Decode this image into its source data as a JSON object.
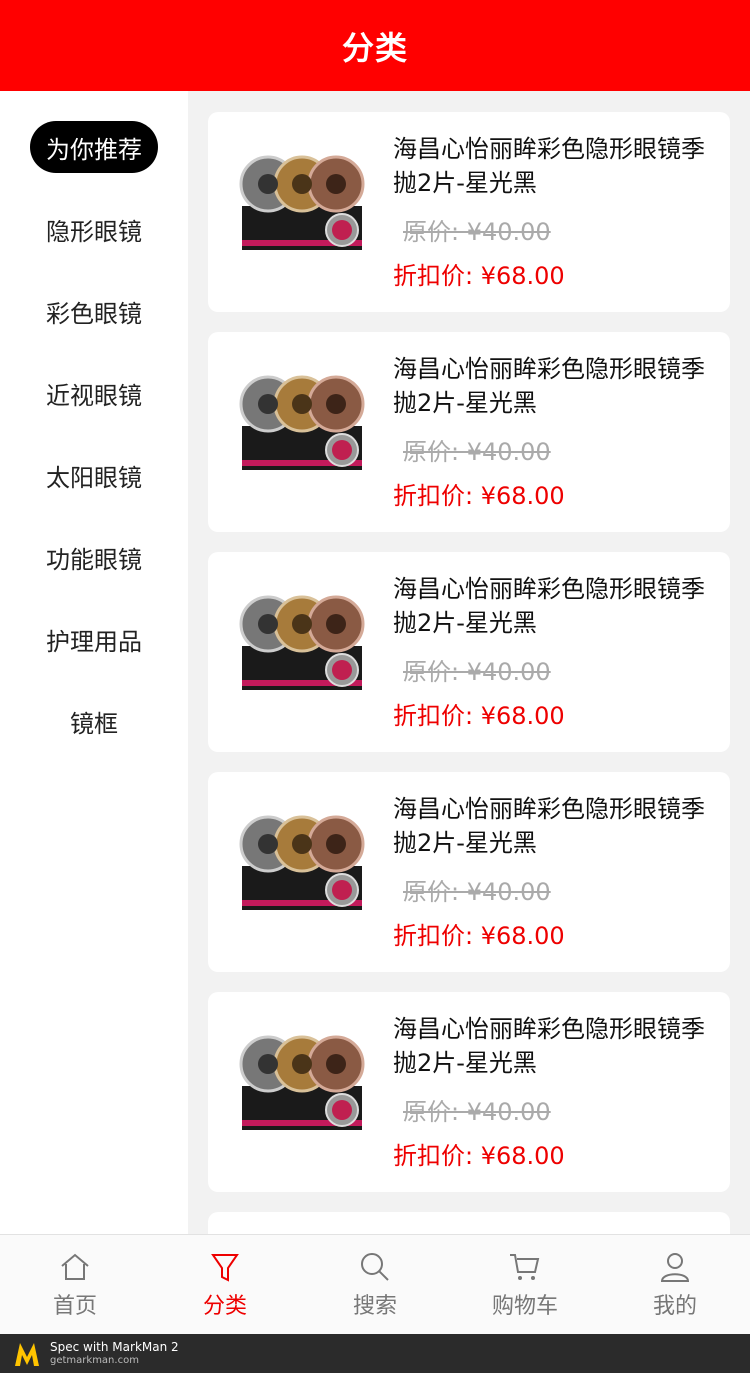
{
  "header": {
    "title": "分类"
  },
  "sidebar": {
    "items": [
      "为你推荐",
      "隐形眼镜",
      "彩色眼镜",
      "近视眼镜",
      "太阳眼镜",
      "功能眼镜",
      "护理用品",
      "镜框"
    ]
  },
  "products": [
    {
      "title": "海昌心怡丽眸彩色隐形眼镜季抛2片-星光黑",
      "original": "原价: ¥40.00",
      "discount": "折扣价: ¥68.00"
    },
    {
      "title": "海昌心怡丽眸彩色隐形眼镜季抛2片-星光黑",
      "original": "原价: ¥40.00",
      "discount": "折扣价: ¥68.00"
    },
    {
      "title": "海昌心怡丽眸彩色隐形眼镜季抛2片-星光黑",
      "original": "原价: ¥40.00",
      "discount": "折扣价: ¥68.00"
    },
    {
      "title": "海昌心怡丽眸彩色隐形眼镜季抛2片-星光黑",
      "original": "原价: ¥40.00",
      "discount": "折扣价: ¥68.00"
    },
    {
      "title": "海昌心怡丽眸彩色隐形眼镜季抛2片-星光黑",
      "original": "原价: ¥40.00",
      "discount": "折扣价: ¥68.00"
    }
  ],
  "tabbar": {
    "items": [
      {
        "label": "首页",
        "icon": "home-icon"
      },
      {
        "label": "分类",
        "icon": "filter-icon",
        "active": true
      },
      {
        "label": "搜索",
        "icon": "search-icon"
      },
      {
        "label": "购物车",
        "icon": "cart-icon"
      },
      {
        "label": "我的",
        "icon": "user-icon"
      }
    ]
  },
  "footer": {
    "brand": "Spec with MarkMan 2",
    "site": "getmarkman.com"
  },
  "colors": {
    "accent": "#ff0000",
    "discount": "#ee0000",
    "active_pill": "#000000"
  }
}
